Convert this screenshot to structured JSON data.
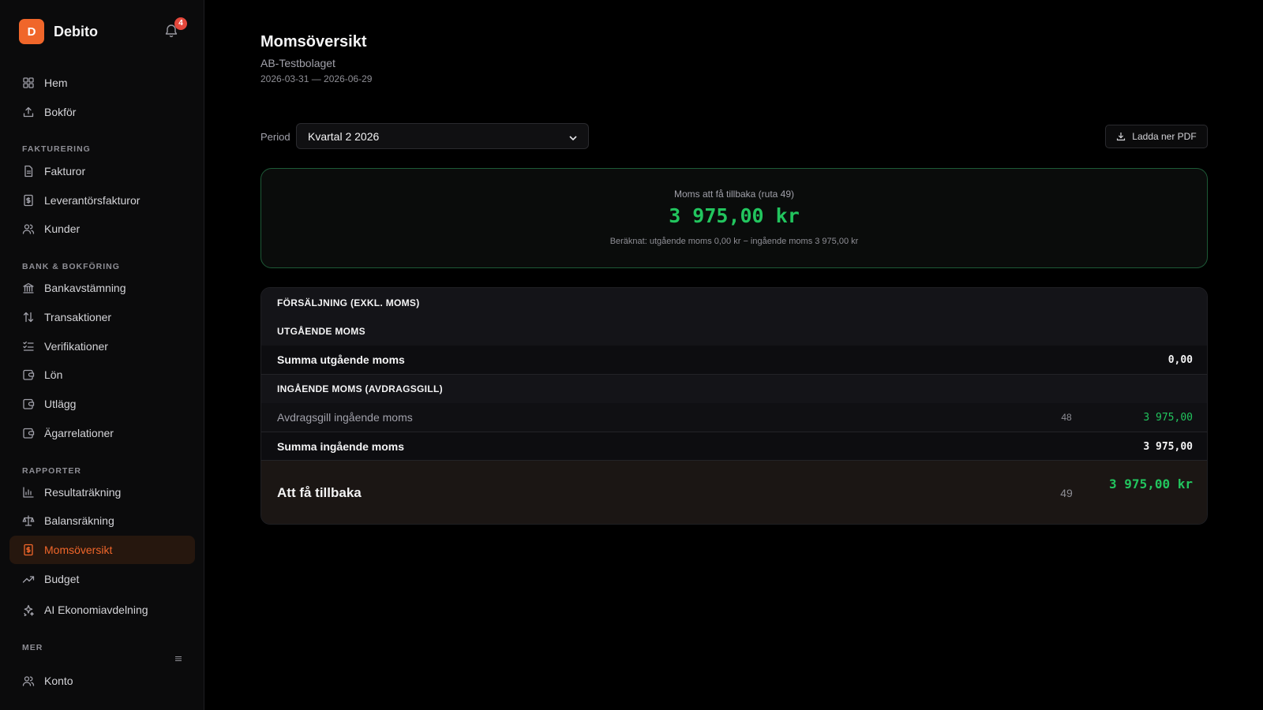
{
  "app": {
    "logo_letter": "D",
    "name": "Debito",
    "notification_count": "4"
  },
  "sidebar": {
    "top_items": [
      {
        "label": "Hem",
        "icon": "grid-icon"
      },
      {
        "label": "Bokför",
        "icon": "upload-icon"
      }
    ],
    "sections": [
      {
        "title": "FAKTURERING",
        "items": [
          {
            "label": "Fakturor",
            "icon": "invoice-icon"
          },
          {
            "label": "Leverantörsfakturor",
            "icon": "receipt-icon"
          },
          {
            "label": "Kunder",
            "icon": "users-icon"
          }
        ]
      },
      {
        "title": "BANK & BOKFÖRING",
        "items": [
          {
            "label": "Bankavstämning",
            "icon": "bank-icon"
          },
          {
            "label": "Transaktioner",
            "icon": "arrows-updown-icon"
          },
          {
            "label": "Verifikationer",
            "icon": "checklist-icon"
          },
          {
            "label": "Lön",
            "icon": "wallet-icon"
          },
          {
            "label": "Utlägg",
            "icon": "wallet-icon"
          },
          {
            "label": "Ägarrelationer",
            "icon": "wallet-icon"
          }
        ]
      },
      {
        "title": "RAPPORTER",
        "items": [
          {
            "label": "Resultaträkning",
            "icon": "bar-chart-icon"
          },
          {
            "label": "Balansräkning",
            "icon": "scale-icon"
          },
          {
            "label": "Momsöversikt",
            "icon": "receipt-icon",
            "active": true
          },
          {
            "label": "Budget",
            "icon": "trend-up-icon"
          },
          {
            "label": "AI Ekonomiavdelning",
            "icon": "sparkle-icon"
          }
        ]
      },
      {
        "title": "MER",
        "items": [
          {
            "label": "Konto",
            "icon": "users-icon"
          }
        ]
      }
    ]
  },
  "page": {
    "title": "Momsöversikt",
    "company": "AB-Testbolaget",
    "date_range": "2026-03-31 — 2026-06-29",
    "period_label": "Period",
    "period_value": "Kvartal 2 2026",
    "pdf_button": "Ladda ner PDF"
  },
  "summary": {
    "label": "Moms att få tillbaka (ruta 49)",
    "amount": "3 975,00 kr",
    "calculation": "Beräknat: utgående moms 0,00 kr − ingående moms 3 975,00 kr"
  },
  "table": {
    "sales_header": "FÖRSÄLJNING (EXKL. MOMS)",
    "output_header": "UTGÅENDE MOMS",
    "output_total_label": "Summa utgående moms",
    "output_total_value": "0,00",
    "input_header": "INGÅENDE MOMS (AVDRAGSGILL)",
    "input_line_label": "Avdragsgill ingående moms",
    "input_line_box": "48",
    "input_line_value": "3 975,00",
    "input_total_label": "Summa ingående moms",
    "input_total_value": "3 975,00",
    "final_label": "Att få tillbaka",
    "final_box": "49",
    "final_value": "3 975,00 kr"
  },
  "colors": {
    "accent": "#f0662a",
    "positive": "#22c55e",
    "badge": "#e5483c"
  }
}
